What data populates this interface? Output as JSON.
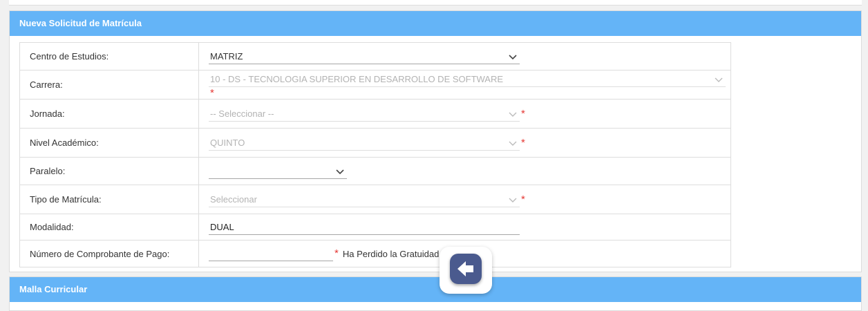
{
  "panel1": {
    "title": "Nueva Solicitud de Matrícula"
  },
  "panel2": {
    "title": "Malla Curricular"
  },
  "form": {
    "centro": {
      "label": "Centro de Estudios:",
      "value": "MATRIZ"
    },
    "carrera": {
      "label": "Carrera:",
      "value": "10 - DS - TECNOLOGIA SUPERIOR EN DESARROLLO DE SOFTWARE",
      "required": "*"
    },
    "jornada": {
      "label": "Jornada:",
      "value": "-- Seleccionar --",
      "required": "*"
    },
    "nivel": {
      "label": "Nivel Académico:",
      "value": "QUINTO",
      "required": "*"
    },
    "paralelo": {
      "label": "Paralelo:",
      "value": ""
    },
    "tipo": {
      "label": "Tipo de Matrícula:",
      "value": "Seleccionar",
      "required": "*"
    },
    "modalidad": {
      "label": "Modalidad:",
      "value": "DUAL"
    },
    "comprobante": {
      "label": "Número de Comprobante de Pago:",
      "value": "",
      "required": "*",
      "note": "Ha Perdido la Gratuidad"
    }
  },
  "colors": {
    "header": "#64b4f7",
    "required": "#e53935",
    "fab": "#4a5a8e"
  },
  "icons": {
    "dropdown": "chevron-down-icon",
    "back": "arrow-left-icon"
  }
}
